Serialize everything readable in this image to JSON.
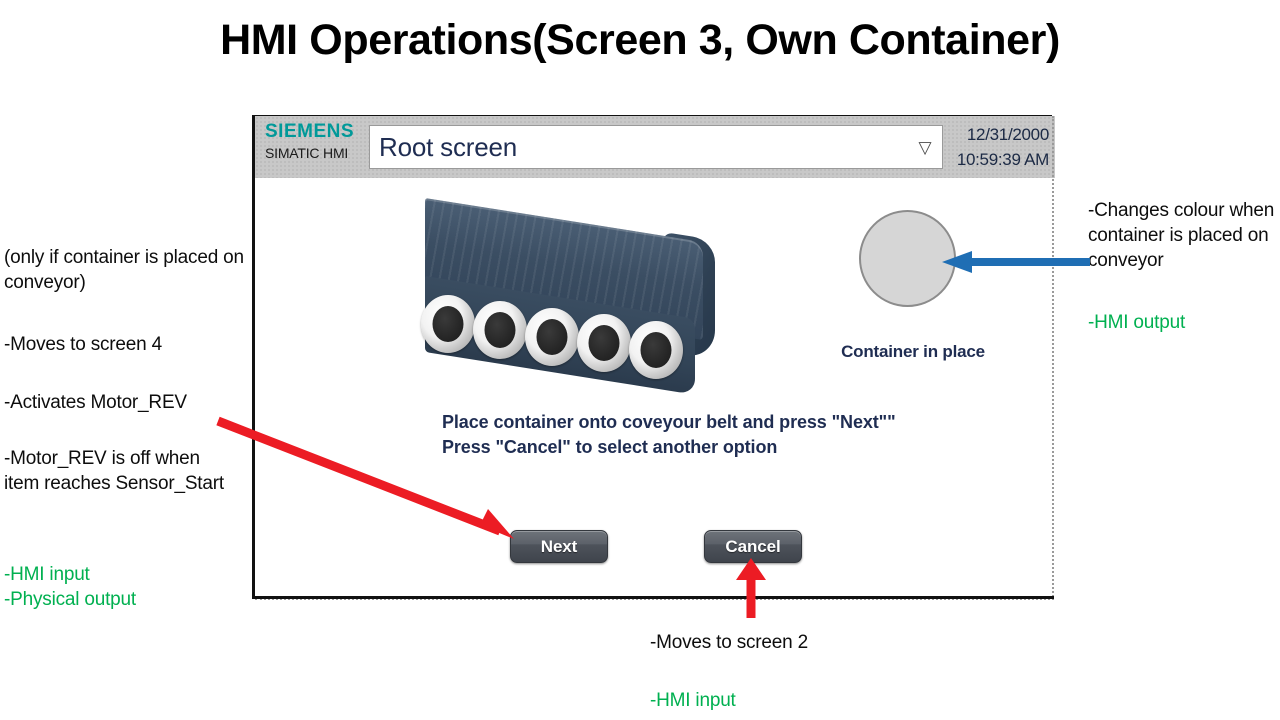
{
  "slide": {
    "title": "HMI Operations(Screen 3, Own Container)"
  },
  "hmi": {
    "header": {
      "brand": "SIEMENS",
      "product": "SIMATIC HMI",
      "screen_select": {
        "value": "Root screen",
        "arrow_icon": "chevron-down-icon"
      },
      "date": "12/31/2000",
      "time": "10:59:39 AM"
    },
    "graphic": {
      "conveyor_name": "conveyor-belt-graphic",
      "roller_count": 5
    },
    "indicator": {
      "label": "Container in place",
      "state_color": "#d6d6d6",
      "border_color": "#8c8c8c"
    },
    "instructions": {
      "line1": "Place container onto coveyour belt and press \"Next\"\"",
      "line2": "Press \"Cancel\" to select another option"
    },
    "buttons": {
      "next": "Next",
      "cancel": "Cancel"
    }
  },
  "annotations": {
    "left": {
      "only_if": "(only if container is placed on conveyor)",
      "moves_to_screen_4": "-Moves to screen 4",
      "activates_motor_rev": "-Activates Motor_REV",
      "motor_rev_off": "-Motor_REV is off when item reaches Sensor_Start",
      "tags": "-HMI input\n-Physical output"
    },
    "right": {
      "changes_colour": "-Changes colour when container is placed on conveyor",
      "tags": "-HMI output"
    },
    "bottom": {
      "moves_to_screen_2": "-Moves to screen 2",
      "tags": "-HMI input"
    }
  },
  "colors": {
    "green_tag": "#00b050",
    "red_arrow": "#ec1c24",
    "blue_arrow": "#1f6eb4",
    "siemens_teal": "#009999",
    "hmi_text_navy": "#1f2d52"
  }
}
